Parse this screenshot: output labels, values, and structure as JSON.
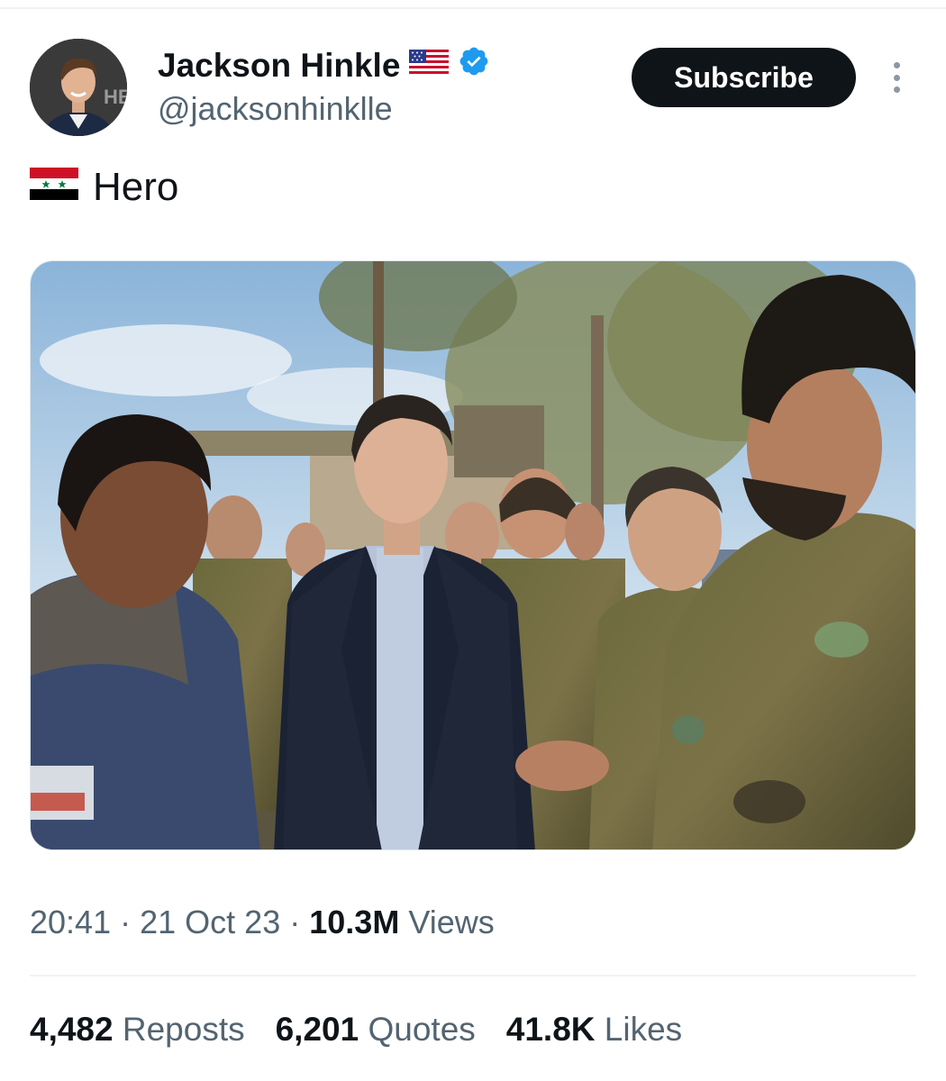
{
  "author": {
    "display_name": "Jackson Hinkle",
    "handle": "@jacksonhinklle",
    "avatar_badge_text": "HB",
    "verified": true,
    "name_flag_icon": "us-flag-icon",
    "verified_icon": "verified-badge-icon"
  },
  "header": {
    "subscribe_label": "Subscribe",
    "more_icon": "more-vertical-icon"
  },
  "tweet": {
    "flag_icon": "syria-flag-icon",
    "text": "Hero"
  },
  "meta": {
    "time": "20:41",
    "separator": "·",
    "date": "21 Oct 23",
    "views_count": "10.3M",
    "views_label": "Views"
  },
  "stats": {
    "reposts_count": "4,482",
    "reposts_label": "Reposts",
    "quotes_count": "6,201",
    "quotes_label": "Quotes",
    "likes_count": "41.8K",
    "likes_label": "Likes"
  },
  "colors": {
    "text_primary": "#0f1419",
    "text_secondary": "#536471",
    "verified_blue": "#1d9bf0",
    "button_bg": "#0f1419"
  }
}
